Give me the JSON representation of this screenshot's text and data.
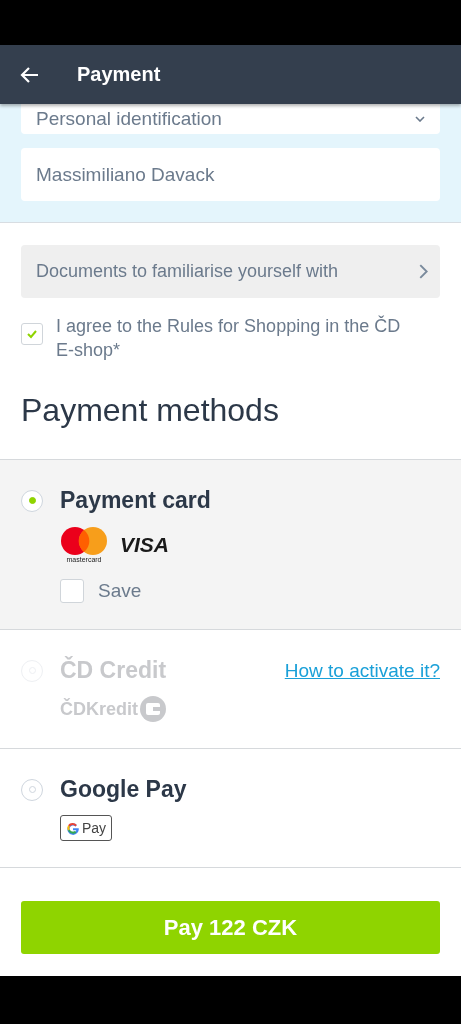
{
  "header": {
    "title": "Payment"
  },
  "identity": {
    "id_type": "Personal identification",
    "name": "Massimiliano Davack"
  },
  "documents": {
    "label": "Documents to familiarise yourself with"
  },
  "agreement": {
    "label": "I agree to the Rules for Shopping in the ČD E-shop*",
    "checked": true
  },
  "methods_title": "Payment methods",
  "methods": [
    {
      "name": "Payment card",
      "selected": true,
      "disabled": false,
      "logos": [
        {
          "kind": "mastercard",
          "text": "mastercard"
        },
        {
          "kind": "visa",
          "text": "VISA"
        }
      ],
      "save": {
        "label": "Save",
        "checked": false
      }
    },
    {
      "name": "ČD Credit",
      "selected": false,
      "disabled": true,
      "link": "How to activate it?",
      "logos": [
        {
          "kind": "cdkredit",
          "text": "ČDKredit"
        }
      ]
    },
    {
      "name": "Google Pay",
      "selected": false,
      "disabled": false,
      "logos": [
        {
          "kind": "gpay",
          "text": "Pay"
        }
      ]
    }
  ],
  "pay_button": "Pay 122 CZK"
}
